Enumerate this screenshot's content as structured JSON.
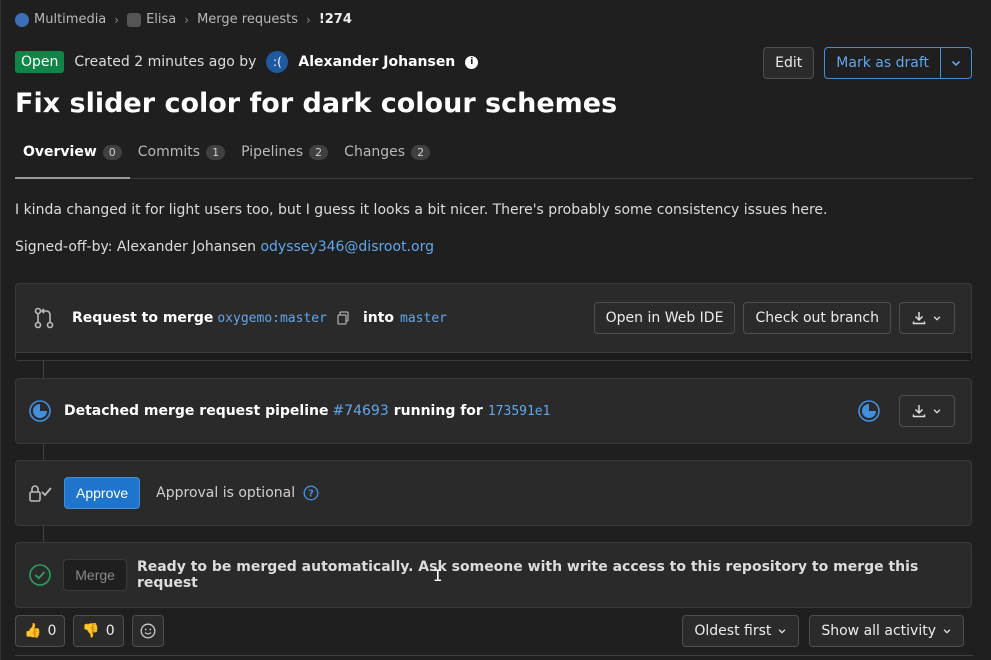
{
  "breadcrumb": {
    "group": "Multimedia",
    "project": "Elisa",
    "section": "Merge requests",
    "current": "!274"
  },
  "header": {
    "status": "Open",
    "created_text": "Created 2 minutes ago by",
    "author_initials": ":(",
    "author_name": "Alexander Johansen",
    "edit_label": "Edit",
    "draft_label": "Mark as draft"
  },
  "title": "Fix slider color for dark colour schemes",
  "tabs": [
    {
      "label": "Overview",
      "count": "0"
    },
    {
      "label": "Commits",
      "count": "1"
    },
    {
      "label": "Pipelines",
      "count": "2"
    },
    {
      "label": "Changes",
      "count": "2"
    }
  ],
  "description": {
    "line1": "I kinda changed it for light users too, but I guess it looks a bit nicer. There's probably some consistency issues here.",
    "signoff_prefix": "Signed-off-by: Alexander Johansen",
    "signoff_email": "odyssey346@disroot.org"
  },
  "merge_request_widget": {
    "label": "Request to merge",
    "source": "oxygemo:master",
    "into_label": "into",
    "target": "master",
    "web_ide_label": "Open in Web IDE",
    "checkout_label": "Check out branch"
  },
  "pipeline": {
    "label": "Detached merge request pipeline",
    "pipeline_id": "#74693",
    "running_label": "running for",
    "commit": "173591e1"
  },
  "approval": {
    "approve_label": "Approve",
    "optional_text": "Approval is optional"
  },
  "merge": {
    "merge_label": "Merge",
    "ready_text": "Ready to be merged automatically. Ask someone with write access to this repository to merge this request"
  },
  "footer": {
    "thumbs_up_count": "0",
    "thumbs_down_count": "0",
    "sort_label": "Oldest first",
    "filter_label": "Show all activity"
  }
}
